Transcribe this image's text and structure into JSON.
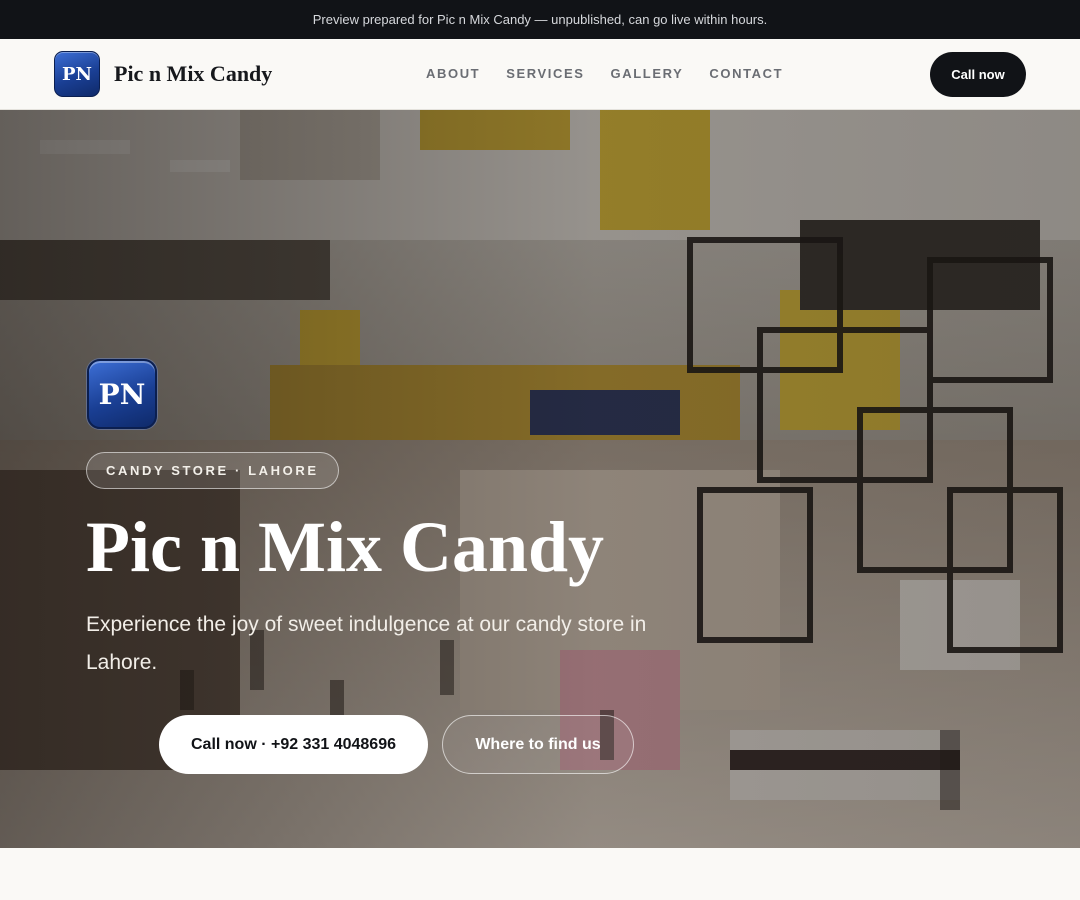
{
  "preview_banner": {
    "text": "Preview prepared for Pic n Mix Candy — unpublished, can go live within hours."
  },
  "header": {
    "logo_text": "PN",
    "brand_name": "Pic n Mix Candy",
    "nav": [
      {
        "label": "ABOUT"
      },
      {
        "label": "SERVICES"
      },
      {
        "label": "GALLERY"
      },
      {
        "label": "CONTACT"
      }
    ],
    "cta_label": "Call now"
  },
  "hero": {
    "logo_text": "PN",
    "badge": "CANDY STORE · LAHORE",
    "title": "Pic n Mix Candy",
    "subtitle": "Experience the joy of sweet indulgence at our candy store in Lahore.",
    "primary_button": "Call now · +92 331 4048696",
    "secondary_button": "Where to find us"
  },
  "colors": {
    "dark": "#111317",
    "brand_blue": "#1a3f94",
    "page_bg": "#faf9f6"
  }
}
